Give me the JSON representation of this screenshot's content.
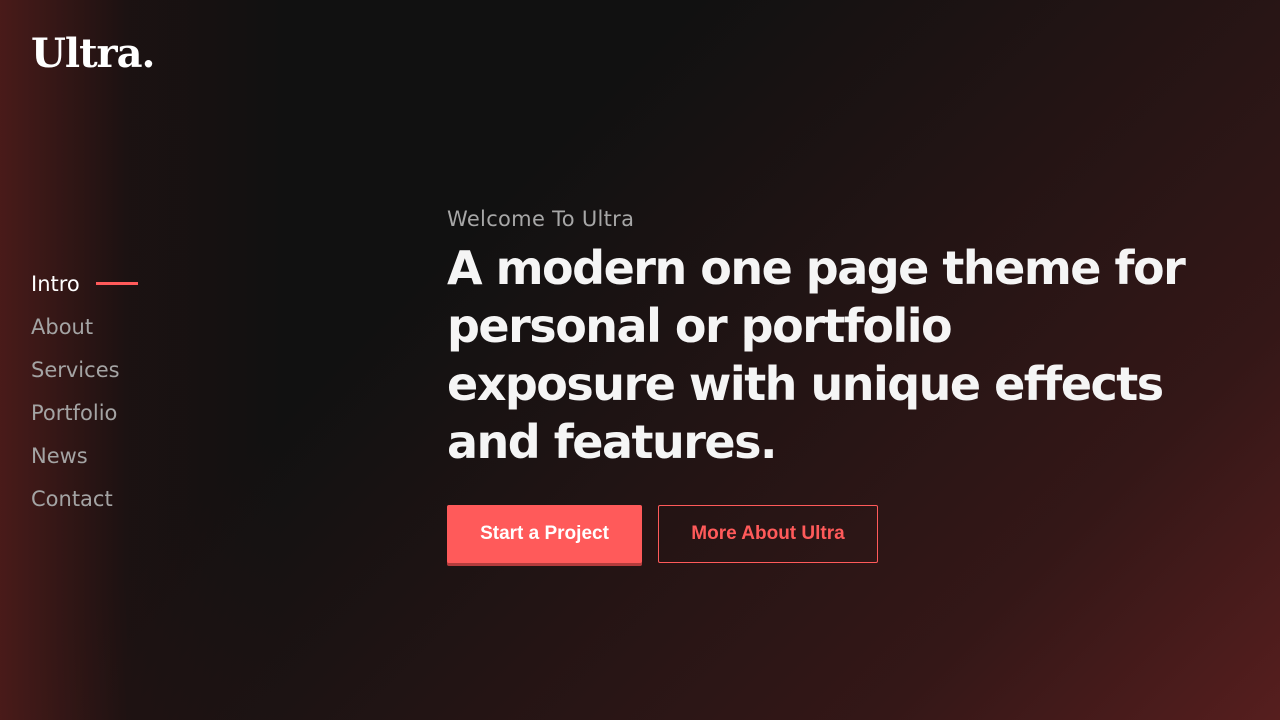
{
  "brand": {
    "name": "Ultra",
    "dot": "."
  },
  "nav": {
    "items": [
      {
        "label": "Intro",
        "active": true
      },
      {
        "label": "About",
        "active": false
      },
      {
        "label": "Services",
        "active": false
      },
      {
        "label": "Portfolio",
        "active": false
      },
      {
        "label": "News",
        "active": false
      },
      {
        "label": "Contact",
        "active": false
      }
    ]
  },
  "hero": {
    "eyebrow": "Welcome To Ultra",
    "headline": "A modern one page theme for personal or portfolio exposure with unique effects and features.",
    "primary_cta": "Start a Project",
    "secondary_cta": "More About Ultra"
  },
  "colors": {
    "accent": "#ff5a5a",
    "background": "#111111",
    "text": "#ffffff",
    "muted": "#a4a4a4"
  }
}
